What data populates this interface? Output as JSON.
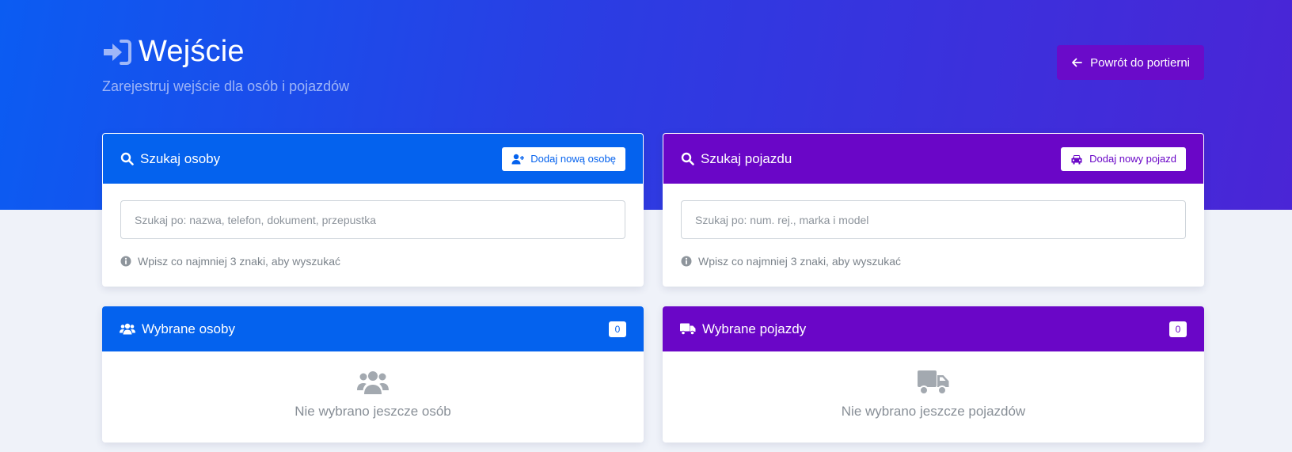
{
  "header": {
    "title": "Wejście",
    "subtitle": "Zarejestruj wejście dla osób i pojazdów",
    "back_label": "Powrót do portierni"
  },
  "person_search": {
    "title": "Szukaj osoby",
    "add_label": "Dodaj nową osobę",
    "placeholder": "Szukaj po: nazwa, telefon, dokument, przepustka",
    "hint": "Wpisz co najmniej 3 znaki, aby wyszukać"
  },
  "vehicle_search": {
    "title": "Szukaj pojazdu",
    "add_label": "Dodaj nowy pojazd",
    "placeholder": "Szukaj po: num. rej., marka i model",
    "hint": "Wpisz co najmniej 3 znaki, aby wyszukać"
  },
  "selected_persons": {
    "title": "Wybrane osoby",
    "count": "0",
    "empty_text": "Nie wybrano jeszcze osób"
  },
  "selected_vehicles": {
    "title": "Wybrane pojazdy",
    "count": "0",
    "empty_text": "Nie wybrano jeszcze pojazdów"
  },
  "icons": {
    "title": "sign-in-icon",
    "back": "arrow-left-icon",
    "search": "search-icon",
    "add_person": "user-plus-icon",
    "add_vehicle": "car-icon",
    "info": "info-circle-icon",
    "persons": "users-icon",
    "vehicles": "truck-icon"
  },
  "colors": {
    "primary_blue": "#0462ee",
    "primary_purple": "#6a06c7",
    "hero_gradient_start": "#0b5cf2",
    "hero_gradient_end": "#4a25d6"
  }
}
